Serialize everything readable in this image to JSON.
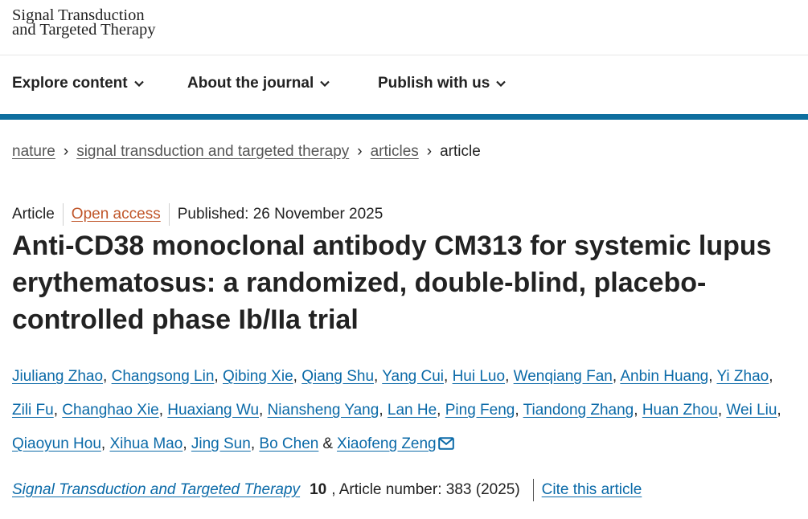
{
  "site": {
    "logo_line1": "Signal Transduction",
    "logo_line2": "and Targeted Therapy"
  },
  "nav": {
    "items": [
      {
        "label": "Explore content"
      },
      {
        "label": "About the journal"
      },
      {
        "label": "Publish with us"
      }
    ],
    "accent_color": "#0f6f9f"
  },
  "breadcrumb": {
    "items": [
      "nature",
      "signal transduction and targeted therapy",
      "articles"
    ],
    "current": "article"
  },
  "article": {
    "type": "Article",
    "access": "Open access",
    "published": "Published: 26 November 2025",
    "title": "Anti-CD38 monoclonal antibody CM313 for systemic lupus erythematosus: a randomized, double-blind, placebo-controlled phase Ib/IIa trial",
    "authors": [
      "Jiuliang Zhao",
      "Changsong Lin",
      "Qibing Xie",
      "Qiang Shu",
      "Yang Cui",
      "Hui Luo",
      "Wenqiang Fan",
      "Anbin Huang",
      "Yi Zhao",
      "Zili Fu",
      "Changhao Xie",
      "Huaxiang Wu",
      "Niansheng Yang",
      "Lan He",
      "Ping Feng",
      "Tiandong Zhang",
      "Huan Zhou",
      "Wei Liu",
      "Qiaoyun Hou",
      "Xihua Mao",
      "Jing Sun",
      "Bo Chen"
    ],
    "and_symbol": "&",
    "corresponding_author": "Xiaofeng Zeng",
    "journal": "Signal Transduction and Targeted Therapy",
    "volume": "10",
    "article_number": ", Article number: 383 (2025)",
    "cite_label": "Cite this article"
  },
  "colors": {
    "link": "#0b6aa8",
    "open_access": "#c0562a",
    "text": "#222222"
  },
  "icons": {
    "nav_chevron": "chevron-down-icon",
    "email": "envelope-icon"
  }
}
